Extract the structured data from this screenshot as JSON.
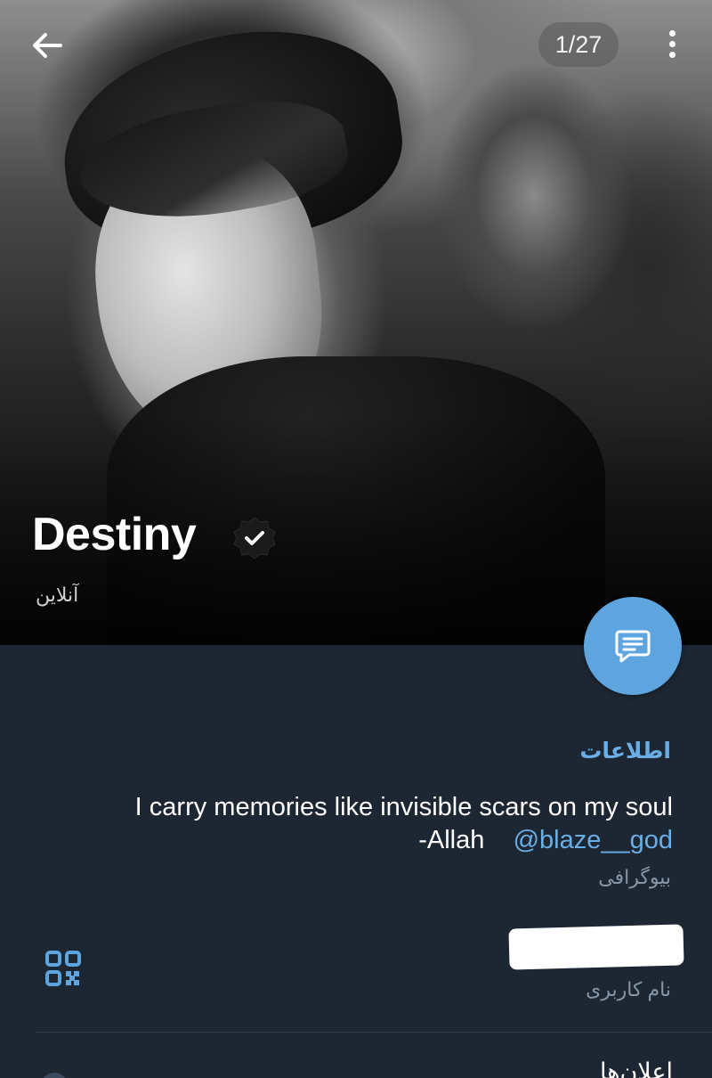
{
  "header": {
    "photo_counter": "1/27",
    "name": "Destiny",
    "status": "آنلاین"
  },
  "info": {
    "section_title": "اطلاعات",
    "bio_line1": "I carry memories like invisible scars on my soul",
    "bio_line2_text": "-Allah",
    "bio_mention": "@blaze__god",
    "bio_label": "بیوگرافی",
    "username_label": "نام کاربری",
    "notifications_label": "اعلان‌ها"
  },
  "colors": {
    "accent": "#6aaee6",
    "fab": "#5ea5e0",
    "background": "#1d2733",
    "secondary_text": "#8796a6"
  },
  "icons": {
    "back": "arrow-left-icon",
    "more": "more-vertical-icon",
    "verified": "verified-badge-icon",
    "chat": "message-icon",
    "qr": "qr-code-icon"
  }
}
